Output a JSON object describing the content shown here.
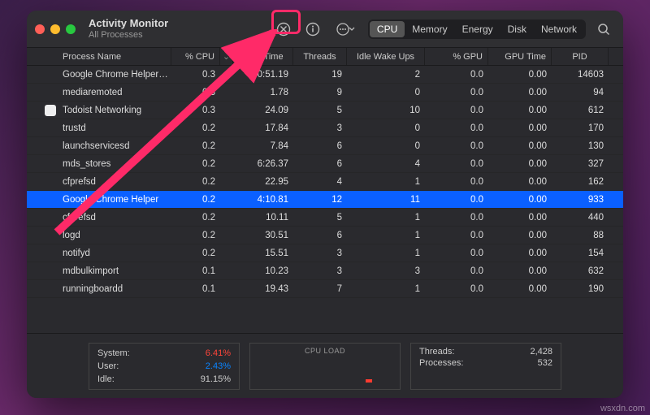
{
  "window": {
    "title": "Activity Monitor",
    "subtitle": "All Processes"
  },
  "tabs": {
    "cpu": "CPU",
    "memory": "Memory",
    "energy": "Energy",
    "disk": "Disk",
    "network": "Network"
  },
  "columns": {
    "name": "Process Name",
    "cpu": "% CPU",
    "time": "CPU Time",
    "threads": "Threads",
    "idle": "Idle Wake Ups",
    "gpu": "% GPU",
    "gputime": "GPU Time",
    "pid": "PID"
  },
  "rows": [
    {
      "name": "Google Chrome Helper…",
      "cpu": "0.3",
      "time": "30:51.19",
      "threads": "19",
      "idle": "2",
      "gpu": "0.0",
      "gputime": "0.00",
      "pid": "14603",
      "icon": false
    },
    {
      "name": "mediaremoted",
      "cpu": "0.3",
      "time": "1.78",
      "threads": "9",
      "idle": "0",
      "gpu": "0.0",
      "gputime": "0.00",
      "pid": "94",
      "icon": false
    },
    {
      "name": "Todoist Networking",
      "cpu": "0.3",
      "time": "24.09",
      "threads": "5",
      "idle": "10",
      "gpu": "0.0",
      "gputime": "0.00",
      "pid": "612",
      "icon": true
    },
    {
      "name": "trustd",
      "cpu": "0.2",
      "time": "17.84",
      "threads": "3",
      "idle": "0",
      "gpu": "0.0",
      "gputime": "0.00",
      "pid": "170",
      "icon": false
    },
    {
      "name": "launchservicesd",
      "cpu": "0.2",
      "time": "7.84",
      "threads": "6",
      "idle": "0",
      "gpu": "0.0",
      "gputime": "0.00",
      "pid": "130",
      "icon": false
    },
    {
      "name": "mds_stores",
      "cpu": "0.2",
      "time": "6:26.37",
      "threads": "6",
      "idle": "4",
      "gpu": "0.0",
      "gputime": "0.00",
      "pid": "327",
      "icon": false
    },
    {
      "name": "cfprefsd",
      "cpu": "0.2",
      "time": "22.95",
      "threads": "4",
      "idle": "1",
      "gpu": "0.0",
      "gputime": "0.00",
      "pid": "162",
      "icon": false
    },
    {
      "name": "Google Chrome Helper",
      "cpu": "0.2",
      "time": "4:10.81",
      "threads": "12",
      "idle": "11",
      "gpu": "0.0",
      "gputime": "0.00",
      "pid": "933",
      "icon": false,
      "selected": true
    },
    {
      "name": "cfprefsd",
      "cpu": "0.2",
      "time": "10.11",
      "threads": "5",
      "idle": "1",
      "gpu": "0.0",
      "gputime": "0.00",
      "pid": "440",
      "icon": false
    },
    {
      "name": "logd",
      "cpu": "0.2",
      "time": "30.51",
      "threads": "6",
      "idle": "1",
      "gpu": "0.0",
      "gputime": "0.00",
      "pid": "88",
      "icon": false
    },
    {
      "name": "notifyd",
      "cpu": "0.2",
      "time": "15.51",
      "threads": "3",
      "idle": "1",
      "gpu": "0.0",
      "gputime": "0.00",
      "pid": "154",
      "icon": false
    },
    {
      "name": "mdbulkimport",
      "cpu": "0.1",
      "time": "10.23",
      "threads": "3",
      "idle": "3",
      "gpu": "0.0",
      "gputime": "0.00",
      "pid": "632",
      "icon": false
    },
    {
      "name": "runningboardd",
      "cpu": "0.1",
      "time": "19.43",
      "threads": "7",
      "idle": "1",
      "gpu": "0.0",
      "gputime": "0.00",
      "pid": "190",
      "icon": false
    }
  ],
  "summary": {
    "system_label": "System:",
    "system_value": "6.41%",
    "user_label": "User:",
    "user_value": "2.43%",
    "idle_label": "Idle:",
    "idle_value": "91.15%",
    "cpu_load_label": "CPU LOAD",
    "threads_label": "Threads:",
    "threads_value": "2,428",
    "processes_label": "Processes:",
    "processes_value": "532"
  },
  "watermark": "wsxdn.com"
}
